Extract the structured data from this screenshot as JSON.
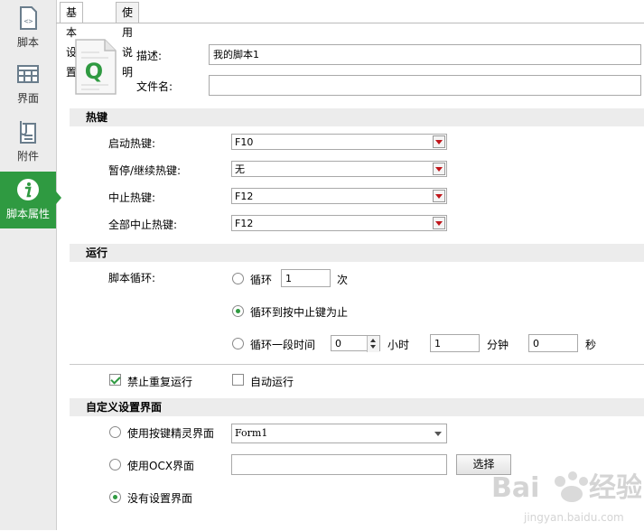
{
  "sidebar": {
    "items": [
      {
        "label": "脚本",
        "icon": "script-file-icon"
      },
      {
        "label": "界面",
        "icon": "grid-icon"
      },
      {
        "label": "附件",
        "icon": "paperclip-document-icon"
      },
      {
        "label": "脚本属性",
        "icon": "info-icon"
      }
    ]
  },
  "tabs": [
    {
      "label": "基本设置",
      "active": true
    },
    {
      "label": "使用说明",
      "active": false
    }
  ],
  "header": {
    "description_label": "描述:",
    "description_value": "我的脚本1",
    "filename_label": "文件名:",
    "filename_value": "",
    "file_icon_letter": "Q"
  },
  "hotkeys": {
    "section_title": "热键",
    "rows": [
      {
        "label": "启动热键:",
        "value": "F10"
      },
      {
        "label": "暂停/继续热键:",
        "value": "无"
      },
      {
        "label": "中止热键:",
        "value": "F12"
      },
      {
        "label": "全部中止热键:",
        "value": "F12"
      }
    ]
  },
  "run": {
    "section_title": "运行",
    "loop_label": "脚本循环:",
    "loop_option": "循环",
    "loop_count": "1",
    "loop_unit": "次",
    "until_stop_option": "循环到按中止键为止",
    "duration_option": "循环一段时间",
    "hours_value": "0",
    "hours_unit": "小时",
    "minutes_value": "1",
    "minutes_unit": "分钟",
    "seconds_value": "0",
    "seconds_unit": "秒",
    "selected": "until_stop"
  },
  "options": {
    "no_repeat_label": "禁止重复运行",
    "no_repeat_checked": true,
    "auto_run_label": "自动运行",
    "auto_run_checked": false
  },
  "custom_ui": {
    "section_title": "自定义设置界面",
    "keyspirit_option": "使用按键精灵界面",
    "form_value": "Form1",
    "ocx_option": "使用OCX界面",
    "ocx_value": "",
    "select_button": "选择",
    "none_option": "没有设置界面",
    "selected": "none"
  },
  "colors": {
    "accent": "#2f9a41",
    "sidebar_bg": "#ececec",
    "section_bg": "#ececec",
    "dropdown_arrow": "#c0161b"
  }
}
